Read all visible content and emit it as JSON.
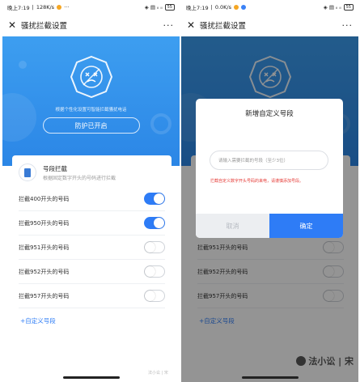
{
  "left": {
    "status": {
      "time": "晚上7:19",
      "speed": "128K/s",
      "extra": "···",
      "battery": "55"
    },
    "title": "骚扰拦截设置",
    "hero": {
      "desc": "根据个性化设置可智能拦截骚扰电话",
      "button": "防护已开启"
    },
    "card": {
      "title": "号段拦截",
      "subtitle": "根据固定数字开头的号码进行拦截"
    },
    "rows": [
      {
        "label": "拦截400开头的号码",
        "on": true
      },
      {
        "label": "拦截950开头的号码",
        "on": true
      },
      {
        "label": "拦截951开头的号码",
        "on": false
      },
      {
        "label": "拦截952开头的号码",
        "on": false
      },
      {
        "label": "拦截957开头的号码",
        "on": false
      }
    ],
    "add_link": "+自定义号段"
  },
  "right": {
    "status": {
      "time": "晚上7:19",
      "speed": "0.0K/s",
      "battery": "55"
    },
    "title": "骚扰拦截设置",
    "rows": [
      {
        "label": "拦截951开头的号码",
        "on": false
      },
      {
        "label": "拦截952开头的号码",
        "on": false
      },
      {
        "label": "拦截957开头的号码",
        "on": false
      }
    ],
    "add_link": "+自定义号段",
    "dialog": {
      "title": "新增自定义号段",
      "placeholder": "请输入需要拦截的号段（至少3位）",
      "error": "拦截自定义数字开头号码的来电，请谨慎添加号段。",
      "cancel": "取消",
      "confirm": "确定"
    }
  },
  "watermark": {
    "text": "法小讼 | 宋",
    "small": "法小讼 | 宋"
  },
  "colors": {
    "accent": "#2e7cf6",
    "hero": "#3d9ef0",
    "error": "#e53935"
  }
}
